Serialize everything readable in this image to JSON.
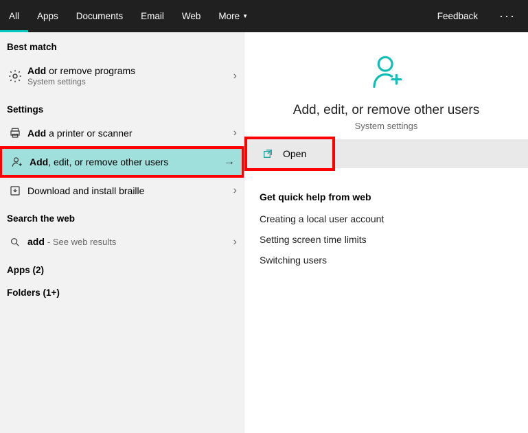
{
  "topbar": {
    "tabs": [
      "All",
      "Apps",
      "Documents",
      "Email",
      "Web",
      "More"
    ],
    "feedback": "Feedback"
  },
  "left": {
    "best_match_label": "Best match",
    "best_match": {
      "title_bold": "Add",
      "title_rest": " or remove programs",
      "sub": "System settings"
    },
    "settings_label": "Settings",
    "settings": [
      {
        "bold": "Add",
        "rest": " a printer or scanner"
      },
      {
        "bold": "Add",
        "rest": ", edit, or remove other users"
      },
      {
        "bold": "",
        "rest": "Download and install braille"
      }
    ],
    "search_label": "Search the web",
    "search_item": {
      "bold": "add",
      "hint": "- See web results"
    },
    "apps_label": "Apps (2)",
    "folders_label": "Folders (1+)"
  },
  "right": {
    "title": "Add, edit, or remove other users",
    "sub": "System settings",
    "open": "Open",
    "quick_title": "Get quick help from web",
    "links": [
      "Creating a local user account",
      "Setting screen time limits",
      "Switching users"
    ]
  }
}
